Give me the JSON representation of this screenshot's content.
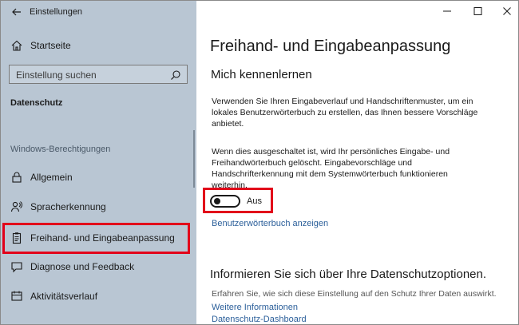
{
  "window": {
    "title": "Einstellungen"
  },
  "sidebar": {
    "home_label": "Startseite",
    "search_placeholder": "Einstellung suchen",
    "section": "Datenschutz",
    "group_label": "Windows-Berechtigungen",
    "items": [
      {
        "label": "Allgemein",
        "icon": "lock-icon"
      },
      {
        "label": "Spracherkennung",
        "icon": "person-speech-icon"
      },
      {
        "label": "Freihand- und Eingabeanpassung",
        "icon": "clipboard-icon",
        "selected": true
      },
      {
        "label": "Diagnose und Feedback",
        "icon": "feedback-icon"
      },
      {
        "label": "Aktivitätsverlauf",
        "icon": "timeline-icon"
      }
    ]
  },
  "content": {
    "title": "Freihand- und Eingabeanpassung",
    "subtitle": "Mich kennenlernen",
    "para1_lines": [
      "Verwenden Sie Ihren Eingabeverlauf und Handschriftenmuster, um ein",
      "lokales Benutzerwörterbuch zu erstellen, das Ihnen bessere Vorschläge",
      "anbietet."
    ],
    "para2_lines": [
      "Wenn dies ausgeschaltet ist, wird Ihr persönliches Eingabe- und",
      "Freihandwörterbuch gelöscht. Eingabevorschläge und",
      "Handschrifterkennung mit dem Systemwörterbuch funktionieren",
      "weiterhin."
    ],
    "toggle": {
      "state_label": "Aus",
      "on": false
    },
    "dictionary_link": "Benutzerwörterbuch anzeigen",
    "info_title": "Informieren Sie sich über Ihre Datenschutzoptionen.",
    "info_text": "Erfahren Sie, wie sich diese Einstellung auf den Schutz Ihrer Daten auswirkt.",
    "info_links": [
      "Weitere Informationen",
      "Datenschutz-Dashboard"
    ]
  },
  "colors": {
    "sidebar_bg": "#b9c6d3",
    "highlight": "#e2001a",
    "link": "#2b5f9a"
  }
}
